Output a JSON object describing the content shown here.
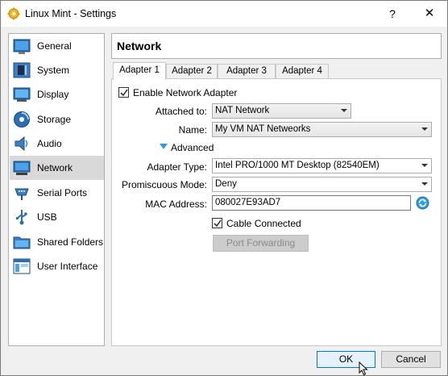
{
  "window": {
    "title": "Linux Mint - Settings",
    "help_glyph": "?",
    "close_glyph": "✕"
  },
  "sidebar": {
    "items": [
      {
        "label": "General",
        "icon": "general-icon",
        "active": false
      },
      {
        "label": "System",
        "icon": "system-icon",
        "active": false
      },
      {
        "label": "Display",
        "icon": "display-icon",
        "active": false
      },
      {
        "label": "Storage",
        "icon": "storage-icon",
        "active": false
      },
      {
        "label": "Audio",
        "icon": "audio-icon",
        "active": false
      },
      {
        "label": "Network",
        "icon": "network-icon",
        "active": true
      },
      {
        "label": "Serial Ports",
        "icon": "serial-ports-icon",
        "active": false
      },
      {
        "label": "USB",
        "icon": "usb-icon",
        "active": false
      },
      {
        "label": "Shared Folders",
        "icon": "shared-folders-icon",
        "active": false
      },
      {
        "label": "User Interface",
        "icon": "user-interface-icon",
        "active": false
      }
    ]
  },
  "page": {
    "title": "Network"
  },
  "tabs": [
    {
      "label": "Adapter 1",
      "active": true
    },
    {
      "label": "Adapter 2",
      "active": false
    },
    {
      "label": "Adapter 3",
      "active": false
    },
    {
      "label": "Adapter 4",
      "active": false
    }
  ],
  "adapter": {
    "enable_label": "Enable Network Adapter",
    "enable_checked": true,
    "attached_label": "Attached to:",
    "attached_value": "NAT Network",
    "name_label": "Name:",
    "name_value": "My VM NAT Netweorks",
    "advanced_label": "Advanced",
    "adapter_type_label": "Adapter Type:",
    "adapter_type_value": "Intel PRO/1000 MT Desktop (82540EM)",
    "promiscuous_label": "Promiscuous Mode:",
    "promiscuous_value": "Deny",
    "mac_label": "MAC Address:",
    "mac_value": "080027E93AD7",
    "cable_label": "Cable Connected",
    "cable_checked": true,
    "port_forwarding_label": "Port Forwarding"
  },
  "footer": {
    "ok_label": "OK",
    "cancel_label": "Cancel"
  },
  "colors": {
    "accent": "#0078d7",
    "active_item": "#d9d9d9"
  }
}
